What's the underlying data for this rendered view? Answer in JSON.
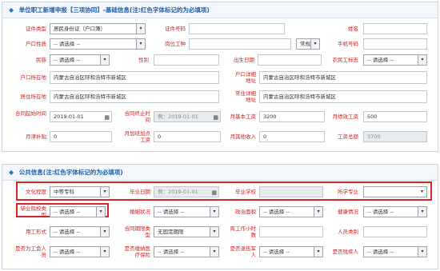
{
  "section1": {
    "title": "单位职工新增申报【三项协同】-基础信息(注:红色字体标记的为必填项)",
    "rows": [
      [
        {
          "label": "证件类型",
          "type": "select",
          "value": "居民身份证（户口簿）"
        },
        {
          "label": "证件号码",
          "type": "input",
          "value": ""
        },
        {
          "label": "姓名",
          "type": "input",
          "value": ""
        }
      ],
      [
        {
          "label": "户口性质",
          "type": "select",
          "value": "-- 请选择 --"
        },
        {
          "label": "岗位工种",
          "type": "input",
          "value": ""
        },
        {
          "label": "",
          "type": "select",
          "value": "常规"
        },
        {
          "label": "手机号码",
          "type": "input",
          "value": ""
        }
      ],
      [
        {
          "label": "民族",
          "type": "select",
          "value": "-- 请选择 --"
        },
        {
          "label": "性别",
          "type": "input",
          "value": ""
        },
        {
          "label": "出生日期",
          "type": "input",
          "value": ""
        },
        {
          "label": "农民工标志",
          "type": "select",
          "value": "-- 请选择 --"
        }
      ],
      [
        {
          "label": "户口所在地",
          "type": "input",
          "value": "内蒙古自治区呼和浩特市新城区"
        },
        {
          "label": "户口详细地址",
          "type": "input",
          "value": "内蒙古自治区呼和浩特市新城区"
        }
      ],
      [
        {
          "label": "居住所在地",
          "type": "input",
          "value": "内蒙古自治区呼和浩特市新城区"
        },
        {
          "label": "常住详细地址",
          "type": "input",
          "value": "内蒙古自治区呼和浩特市新城区"
        }
      ],
      [
        {
          "label": "合同起始时间",
          "type": "date",
          "value": "2019-01-01"
        },
        {
          "label": "合同终止时间",
          "type": "date",
          "value": "例：2019-01-01"
        },
        {
          "label": "月基本工资",
          "type": "input",
          "value": "3200"
        },
        {
          "label": "月绩效工资",
          "type": "input",
          "value": "500"
        }
      ],
      [
        {
          "label": "月津补贴",
          "type": "input",
          "value": "0"
        },
        {
          "label": "月加班加点工资",
          "type": "input",
          "value": "0"
        },
        {
          "label": "月其他收入",
          "type": "input",
          "value": "0"
        },
        {
          "label": "工资总额",
          "type": "input",
          "value": "3700"
        }
      ]
    ]
  },
  "section2": {
    "title": "公共信息(注:红色字体标记的为必填项)",
    "rows": [
      [
        {
          "label": "文化程度",
          "type": "select",
          "value": "中等专科"
        },
        {
          "label": "毕业日期",
          "type": "date",
          "value": "例：2019-01-01"
        },
        {
          "label": "毕业学校",
          "type": "input",
          "value": ""
        },
        {
          "label": "所学专业",
          "type": "select",
          "value": ""
        }
      ],
      [
        {
          "label": "毕业院校类型",
          "type": "select",
          "value": "-- 请选择 --"
        },
        {
          "label": "婚姻状况",
          "type": "select",
          "value": "-- 请选择 --"
        },
        {
          "label": "政治面貌",
          "type": "select",
          "value": "-- 请选择 --"
        },
        {
          "label": "健康情况",
          "type": "select",
          "value": "-- 请选择 --"
        }
      ],
      [
        {
          "label": "用工形式",
          "type": "select",
          "value": "-- 请选择 --"
        },
        {
          "label": "合同期限类型",
          "type": "select",
          "value": "无固定期限"
        },
        {
          "label": "周工作小时数",
          "type": "input",
          "value": ""
        },
        {
          "label": "人员类别",
          "type": "input",
          "value": ""
        }
      ],
      [
        {
          "label": "是否为工会人员",
          "type": "select",
          "value": "-- 请选择 --"
        },
        {
          "label": "是否缴纳医疗保险",
          "type": "select",
          "value": "-- 请选择 --"
        },
        {
          "label": "是否退伍军人",
          "type": "select",
          "value": "-- 请选择 --"
        },
        {
          "label": "是否残疾人",
          "type": "select",
          "value": "-- 请选择 --"
        }
      ]
    ]
  },
  "icons": {
    "header": "diamond-icon",
    "calendar": "calendar-icon"
  },
  "colors": {
    "required_label": "#cc1f1f",
    "header_text": "#1f5fa8",
    "highlight_box": "#d3262e"
  }
}
